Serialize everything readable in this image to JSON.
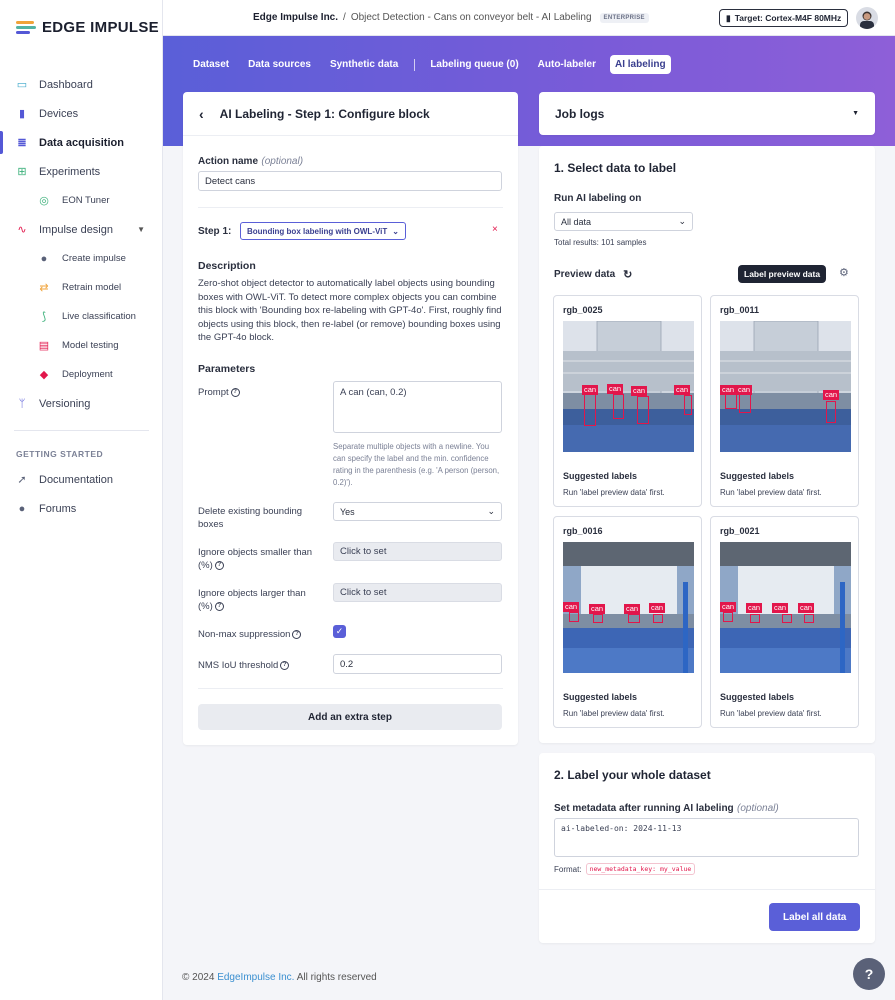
{
  "brand": {
    "name": "EDGE IMPULSE"
  },
  "sidebar": {
    "items": [
      {
        "label": "Dashboard"
      },
      {
        "label": "Devices"
      },
      {
        "label": "Data acquisition"
      },
      {
        "label": "Experiments"
      },
      {
        "label": "EON Tuner"
      },
      {
        "label": "Impulse design"
      },
      {
        "label": "Create impulse"
      },
      {
        "label": "Retrain model"
      },
      {
        "label": "Live classification"
      },
      {
        "label": "Model testing"
      },
      {
        "label": "Deployment"
      },
      {
        "label": "Versioning"
      }
    ],
    "section_label": "GETTING STARTED",
    "bottom_items": [
      {
        "label": "Documentation"
      },
      {
        "label": "Forums"
      }
    ]
  },
  "topbar": {
    "org": "Edge Impulse Inc.",
    "separator": "/",
    "project": "Object Detection - Cans on conveyor belt - AI Labeling",
    "plan_badge": "ENTERPRISE",
    "target": "Target: Cortex-M4F 80MHz"
  },
  "tabs": [
    {
      "label": "Dataset"
    },
    {
      "label": "Data sources"
    },
    {
      "label": "Synthetic data"
    },
    {
      "label": "Labeling queue (0)"
    },
    {
      "label": "Auto-labeler"
    },
    {
      "label": "AI labeling"
    }
  ],
  "config": {
    "title": "AI Labeling - Step 1: Configure block",
    "action_name_label": "Action name",
    "optional": "(optional)",
    "action_name_value": "Detect cans",
    "step_label": "Step 1:",
    "block_name": "Bounding box labeling with OWL-ViT",
    "description_title": "Description",
    "description": "Zero-shot object detector to automatically label objects using bounding boxes with OWL-ViT. To detect more complex objects you can combine this block with 'Bounding box re-labeling with GPT-4o'. First, roughly find objects using this block, then re-label (or remove) bounding boxes using the GPT-4o block.",
    "parameters_title": "Parameters",
    "prompt_label": "Prompt",
    "prompt_value": "A can (can, 0.2)",
    "prompt_help": "Separate multiple objects with a newline. You can specify the label and the min. confidence rating in the parenthesis (e.g. 'A person (person, 0.2)').",
    "delete_label": "Delete existing bounding boxes",
    "delete_value": "Yes",
    "smaller_label": "Ignore objects smaller than (%)",
    "smaller_value": "Click to set",
    "larger_label": "Ignore objects larger than (%)",
    "larger_value": "Click to set",
    "nms_label": "Non-max suppression",
    "nms_checked": true,
    "iou_label": "NMS IoU threshold",
    "iou_value": "0.2",
    "add_step": "Add an extra step"
  },
  "job_logs": {
    "title": "Job logs"
  },
  "select_data": {
    "title": "1. Select data to label",
    "run_on_label": "Run AI labeling on",
    "run_on_value": "All data",
    "total": "Total results: 101 samples",
    "preview_label": "Preview data",
    "label_preview_button": "Label preview data",
    "previews": [
      {
        "name": "rgb_0025",
        "suggested": "Suggested labels",
        "hint": "Run 'label preview data' first."
      },
      {
        "name": "rgb_0011",
        "suggested": "Suggested labels",
        "hint": "Run 'label preview data' first."
      },
      {
        "name": "rgb_0016",
        "suggested": "Suggested labels",
        "hint": "Run 'label preview data' first."
      },
      {
        "name": "rgb_0021",
        "suggested": "Suggested labels",
        "hint": "Run 'label preview data' first."
      }
    ],
    "box_label": "can"
  },
  "label_all": {
    "title": "2. Label your whole dataset",
    "metadata_label": "Set metadata after running AI labeling",
    "optional": "(optional)",
    "metadata_value": "ai-labeled-on: 2024-11-13",
    "format_label": "Format:",
    "format_value": "new_metadata_key: my_value",
    "button": "Label all data"
  },
  "footer": {
    "copyright": "© 2024",
    "company": "EdgeImpulse Inc.",
    "rights": "All rights reserved"
  },
  "colors": {
    "accent": "#5a5fd8",
    "box": "#e2164b",
    "band_start": "#5a5fd8",
    "band_end": "#8e5fd8"
  }
}
